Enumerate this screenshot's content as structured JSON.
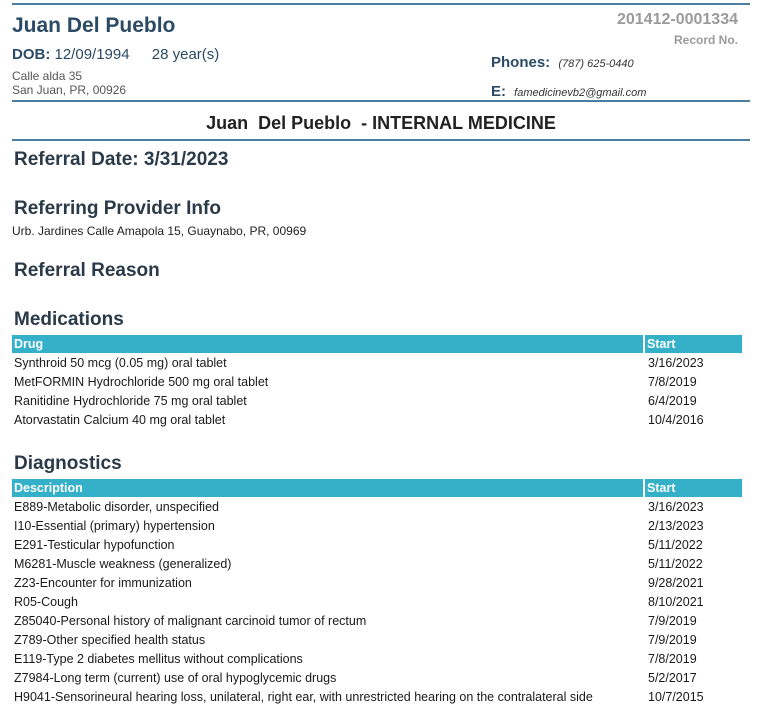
{
  "patient": {
    "name": "Juan Del Pueblo",
    "dob_label": "DOB:",
    "dob": "12/09/1994",
    "age": "28 year(s)",
    "address_line1": "Calle alda 35",
    "address_line2": "San Juan, PR, 00926",
    "record_number": "201412-0001334",
    "record_label": "Record No.",
    "phones_label": "Phones:",
    "phone": "(787) 625-0440",
    "email_label": "E:",
    "email": "famedicinevb2@gmail.com"
  },
  "title": "Juan  Del Pueblo  - INTERNAL MEDICINE",
  "referral_date": "Referral Date: 3/31/2023",
  "referring_provider": {
    "heading": "Referring Provider Info",
    "address": "Urb. Jardines Calle Amapola 15, Guaynabo, PR, 00969"
  },
  "referral_reason": {
    "heading": "Referral Reason"
  },
  "medications": {
    "heading": "Medications",
    "col_drug": "Drug",
    "col_start": "Start",
    "rows": [
      {
        "drug": "Synthroid 50 mcg (0.05 mg) oral tablet",
        "start": "3/16/2023"
      },
      {
        "drug": "MetFORMIN Hydrochloride 500 mg oral tablet",
        "start": "7/8/2019"
      },
      {
        "drug": "Ranitidine Hydrochloride 75 mg oral tablet",
        "start": "6/4/2019"
      },
      {
        "drug": "Atorvastatin Calcium 40 mg oral tablet",
        "start": "10/4/2016"
      }
    ]
  },
  "diagnostics": {
    "heading": "Diagnostics",
    "col_description": "Description",
    "col_start": "Start",
    "rows": [
      {
        "description": "E889-Metabolic disorder, unspecified",
        "start": "3/16/2023"
      },
      {
        "description": "I10-Essential (primary) hypertension",
        "start": "2/13/2023"
      },
      {
        "description": "E291-Testicular hypofunction",
        "start": "5/11/2022"
      },
      {
        "description": "M6281-Muscle weakness (generalized)",
        "start": "5/11/2022"
      },
      {
        "description": "Z23-Encounter for immunization",
        "start": "9/28/2021"
      },
      {
        "description": "R05-Cough",
        "start": "8/10/2021"
      },
      {
        "description": "Z85040-Personal history of malignant carcinoid tumor of rectum",
        "start": "7/9/2019"
      },
      {
        "description": "Z789-Other specified health status",
        "start": "7/9/2019"
      },
      {
        "description": "E119-Type 2 diabetes mellitus without complications",
        "start": "7/8/2019"
      },
      {
        "description": "Z7984-Long term (current) use of oral hypoglycemic drugs",
        "start": "5/2/2017"
      },
      {
        "description": "H9041-Sensorineural hearing loss, unilateral, right ear, with unrestricted hearing on the contralateral side",
        "start": "10/7/2015"
      }
    ]
  }
}
